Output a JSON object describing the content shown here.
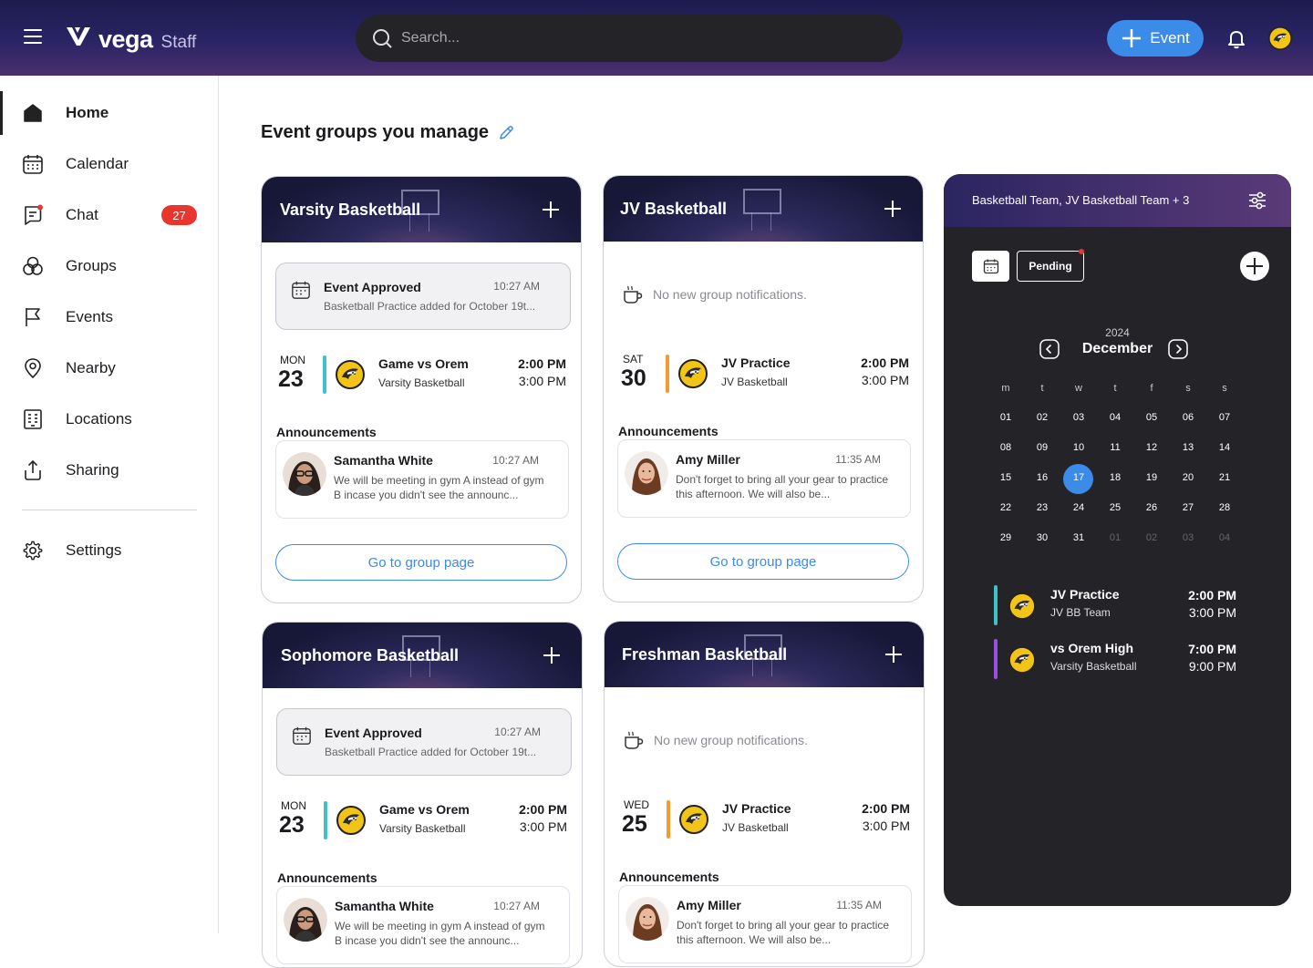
{
  "brand": {
    "name": "vega",
    "sub": "Staff"
  },
  "search": {
    "placeholder": "Search..."
  },
  "header": {
    "event_label": "Event"
  },
  "sidebar": {
    "items": [
      {
        "label": "Home"
      },
      {
        "label": "Calendar"
      },
      {
        "label": "Chat",
        "badge": "27"
      },
      {
        "label": "Groups"
      },
      {
        "label": "Events"
      },
      {
        "label": "Nearby"
      },
      {
        "label": "Locations"
      },
      {
        "label": "Sharing"
      },
      {
        "label": "Settings"
      }
    ]
  },
  "main": {
    "heading": "Event groups you manage",
    "cards": [
      {
        "title": "Varsity Basketball",
        "notif": {
          "title": "Event Approved",
          "time": "10:27 AM",
          "desc": "Basketball Practice added for October 19t..."
        },
        "event": {
          "dow": "MON",
          "day": "23",
          "name": "Game vs Orem",
          "group": "Varsity Basketball",
          "start": "2:00 PM",
          "end": "3:00 PM",
          "color": "#3ec1c7"
        },
        "announcements_label": "Announcements",
        "announcement": {
          "name": "Samantha White",
          "time": "10:27 AM",
          "text": "We will be meeting in gym A instead of gym B incase you didn't see the announc..."
        },
        "goto_label": "Go to group page"
      },
      {
        "title": "JV Basketball",
        "empty_text": "No new group notifications.",
        "event": {
          "dow": "SAT",
          "day": "30",
          "name": "JV Practice",
          "group": "JV Basketball",
          "start": "2:00 PM",
          "end": "3:00 PM",
          "color": "#f59a2f"
        },
        "announcements_label": "Announcements",
        "announcement": {
          "name": "Amy Miller",
          "time": "11:35 AM",
          "text": "Don't forget to bring all your gear to practice this afternoon. We will also be..."
        },
        "goto_label": "Go to group page"
      },
      {
        "title": "Sophomore Basketball",
        "notif": {
          "title": "Event Approved",
          "time": "10:27 AM",
          "desc": "Basketball Practice added for October 19t..."
        },
        "event": {
          "dow": "MON",
          "day": "23",
          "name": "Game vs Orem",
          "group": "Varsity Basketball",
          "start": "2:00 PM",
          "end": "3:00 PM",
          "color": "#3ec1c7"
        },
        "announcements_label": "Announcements",
        "announcement": {
          "name": "Samantha White",
          "time": "10:27 AM",
          "text": "We will be meeting in gym A instead of gym B incase you didn't see the announc..."
        }
      },
      {
        "title": "Freshman Basketball",
        "empty_text": "No new group notifications.",
        "event": {
          "dow": "WED",
          "day": "25",
          "name": "JV Practice",
          "group": "JV Basketball",
          "start": "2:00 PM",
          "end": "3:00 PM",
          "color": "#f59a2f"
        },
        "announcements_label": "Announcements",
        "announcement": {
          "name": "Amy Miller",
          "time": "11:35 AM",
          "text": "Don't forget to bring all your gear to practice this afternoon. We will also be..."
        }
      }
    ]
  },
  "calendar": {
    "filter_text": "Basketball Team, JV Basketball Team + 3",
    "pending_label": "Pending",
    "year": "2024",
    "month": "December",
    "weekdays": [
      "m",
      "t",
      "w",
      "t",
      "f",
      "s",
      "s"
    ],
    "days": [
      "01",
      "02",
      "03",
      "04",
      "05",
      "06",
      "07",
      "08",
      "09",
      "10",
      "11",
      "12",
      "13",
      "14",
      "15",
      "16",
      "17",
      "18",
      "19",
      "20",
      "21",
      "22",
      "23",
      "24",
      "25",
      "26",
      "27",
      "28",
      "29",
      "30",
      "31",
      "01",
      "02",
      "03",
      "04"
    ],
    "selected_day": "17",
    "events": [
      {
        "name": "JV Practice",
        "group": "JV BB Team",
        "start": "2:00 PM",
        "end": "3:00 PM",
        "color": "#3ec1c7"
      },
      {
        "name": "vs Orem High",
        "group": "Varsity Basketball",
        "start": "7:00 PM",
        "end": "9:00 PM",
        "color": "#9b4fe0"
      }
    ]
  },
  "colors": {
    "accent": "#3b8be9",
    "badge": "#e8352d",
    "eagle_yellow": "#f2c418"
  }
}
